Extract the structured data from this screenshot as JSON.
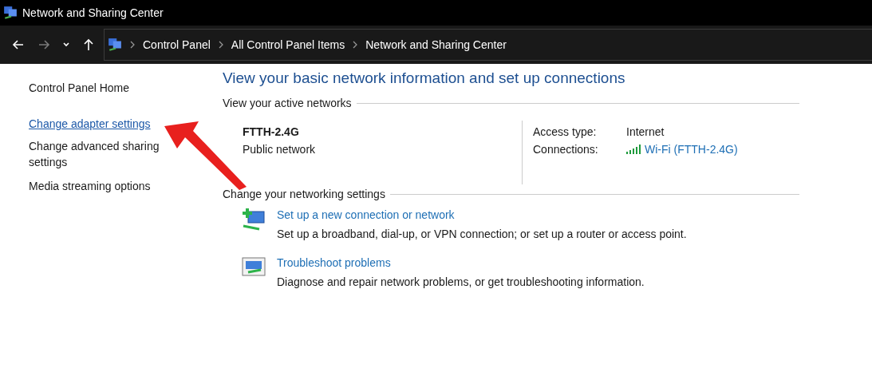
{
  "window": {
    "title": "Network and Sharing Center"
  },
  "navigation": {
    "back": {
      "disabled": false
    },
    "forward": {
      "disabled": true
    },
    "breadcrumbs": [
      "Control Panel",
      "All Control Panel Items",
      "Network and Sharing Center"
    ]
  },
  "sidebar": {
    "items": [
      {
        "label": "Control Panel Home",
        "hovered": false
      },
      {
        "label": "Change adapter settings",
        "hovered": true
      },
      {
        "label": "Change advanced sharing settings",
        "hovered": false
      },
      {
        "label": "Media streaming options",
        "hovered": false
      }
    ]
  },
  "heading": "View your basic network information and set up connections",
  "active_networks": {
    "title": "View your active networks",
    "name": "FTTH-2.4G",
    "category": "Public network",
    "details": [
      {
        "label": "Access type:",
        "value": "Internet",
        "kind": "text"
      },
      {
        "label": "Connections:",
        "value": "Wi-Fi (FTTH-2.4G)",
        "kind": "link"
      }
    ]
  },
  "networking_settings": {
    "title": "Change your networking settings",
    "tasks": [
      {
        "kind": "setup",
        "link": "Set up a new connection or network",
        "description": "Set up a broadband, dial-up, or VPN connection; or set up a router or access point."
      },
      {
        "kind": "troubleshoot",
        "link": "Troubleshoot problems",
        "description": "Diagnose and repair network problems, or get troubleshooting information."
      }
    ]
  }
}
